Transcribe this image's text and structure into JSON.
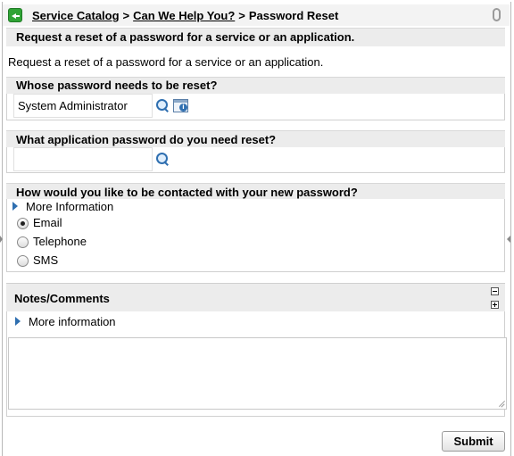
{
  "breadcrumb": {
    "item1": "Service Catalog",
    "sep1": ">",
    "item2": "Can We Help You?",
    "sep2": ">",
    "current": "Password Reset"
  },
  "item_summary": "Request a reset of a password for a service or an application.",
  "item_description": "Request a reset of a password for a service or an application.",
  "who": {
    "label": "Whose password needs to be reset?",
    "value": "System Administrator"
  },
  "application": {
    "label": "What application password do you need reset?",
    "value": ""
  },
  "contact": {
    "label": "How would you like to be contacted with your new password?",
    "more_info": "More Information",
    "options": [
      "Email",
      "Telephone",
      "SMS"
    ],
    "selected": "Email"
  },
  "notes": {
    "label": "Notes/Comments",
    "more_info": "More information",
    "value": ""
  },
  "submit_label": "Submit",
  "colors": {
    "accent_blue": "#2f6fb0",
    "back_green": "#2fa335",
    "header_gray": "#ececec"
  }
}
